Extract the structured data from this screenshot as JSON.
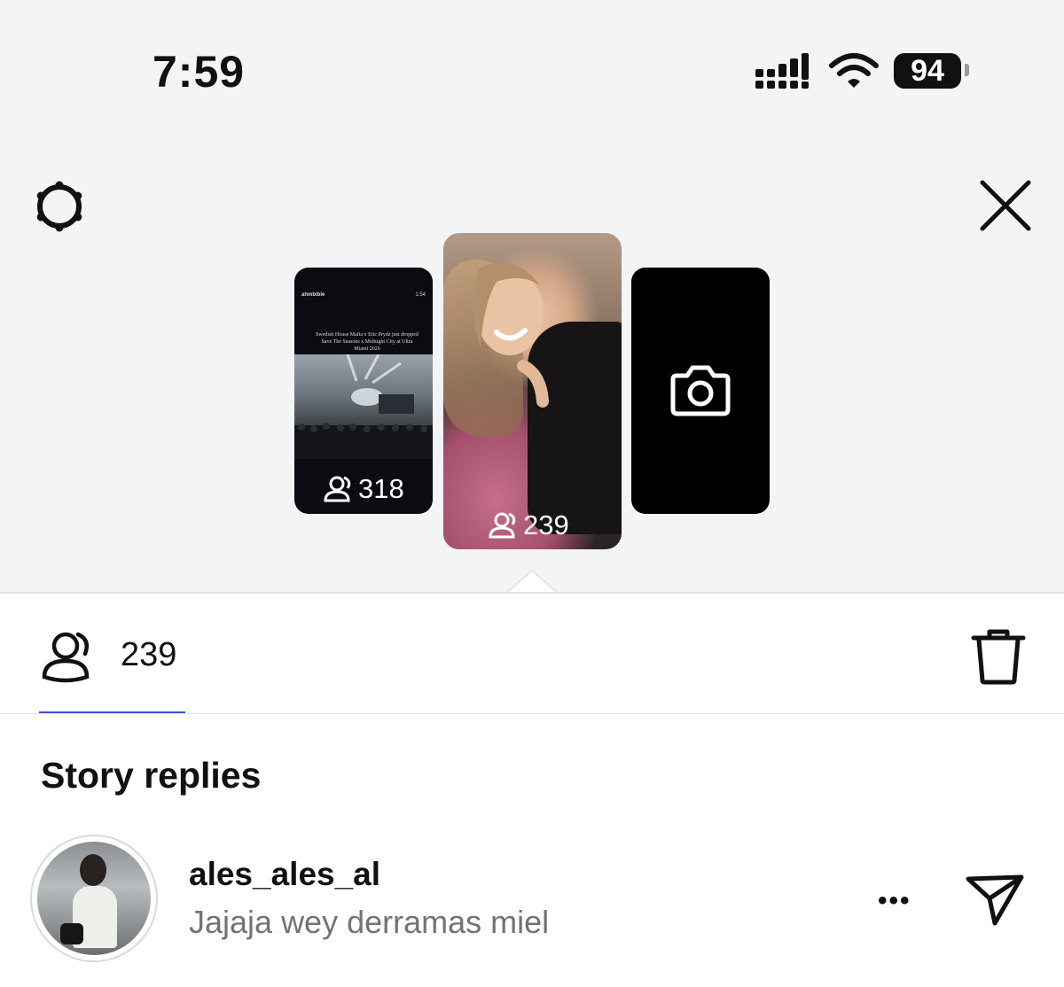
{
  "status_bar": {
    "time": "7:59",
    "battery": "94"
  },
  "header": {
    "settings_icon": "gear-icon",
    "close_icon": "close-icon"
  },
  "stories": [
    {
      "header_text": "ahmbible",
      "time_text": "1:54",
      "caption": "Swedish House Mafia x Eric Prydz just dropped Save The Seasons x Midnight City at Ultra Miami 2026",
      "views": "318"
    },
    {
      "views": "239"
    },
    {
      "icon": "camera-icon"
    }
  ],
  "selected_story": {
    "viewers_icon": "viewers-icon",
    "views_count": "239",
    "delete_icon": "trash-icon"
  },
  "replies": {
    "title": "Story replies",
    "items": [
      {
        "username": "ales_ales_al",
        "message": "Jajaja wey derramas miel",
        "more_label": "•••"
      }
    ]
  },
  "colors": {
    "top_background": "#f3f4f6",
    "tab_underline": "#3f4fd6",
    "muted_text": "#737373"
  }
}
